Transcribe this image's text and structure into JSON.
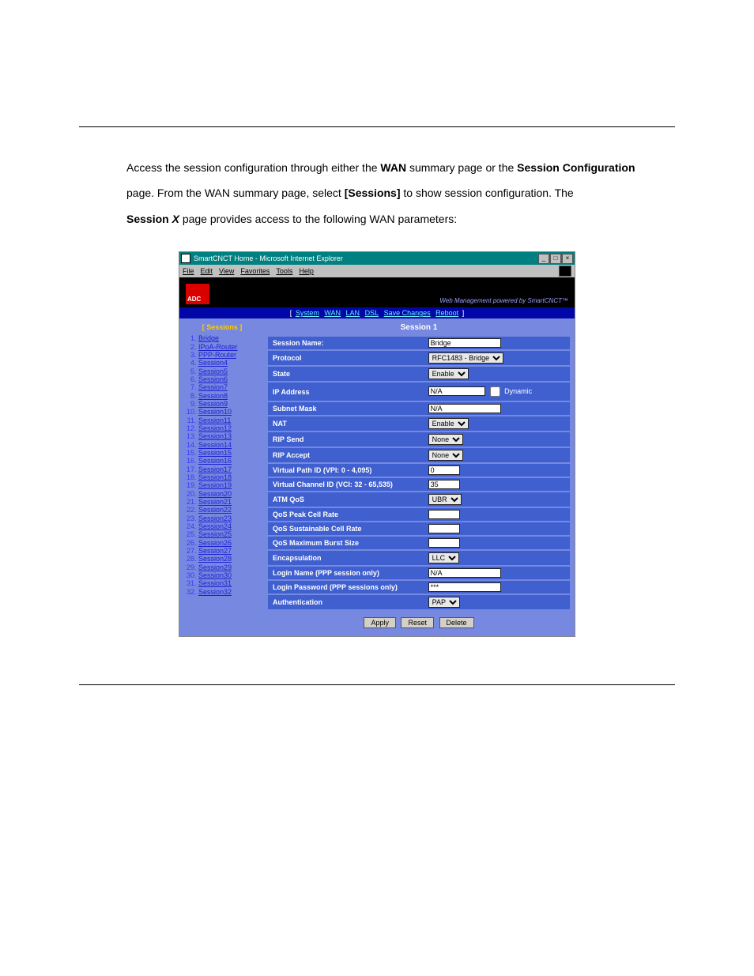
{
  "doc": {
    "line1_pre": "Access the session configuration through either the ",
    "line1_wan": "WAN",
    "line1_mid": " summary page or the ",
    "line1_sc": "Session Configuration",
    "line2_pre": "page. From the WAN summary page, select ",
    "line2_sessions": "[Sessions]",
    "line2_post": " to show session configuration. The",
    "line3_pre": "Session ",
    "line3_x": "X",
    "line3_post": " page provides access to the following WAN parameters:"
  },
  "window": {
    "title": "SmartCNCT Home - Microsoft Internet Explorer",
    "menus": [
      "File",
      "Edit",
      "View",
      "Favorites",
      "Tools",
      "Help"
    ],
    "tagline": "Web Management powered by SmartCNCT™",
    "topnav": [
      "System",
      "WAN",
      "LAN",
      "DSL",
      "Save Changes",
      "Reboot"
    ],
    "sidebar_title": "[ Sessions ]",
    "sidebar_items": [
      "Bridge",
      "IPoA-Router",
      "PPP-Router",
      "Session4",
      "Session5",
      "Session6",
      "Session7",
      "Session8",
      "Session9",
      "Session10",
      "Session11",
      "Session12",
      "Session13",
      "Session14",
      "Session15",
      "Session16",
      "Session17",
      "Session18",
      "Session19",
      "Session20",
      "Session21",
      "Session22",
      "Session23",
      "Session24",
      "Session25",
      "Session26",
      "Session27",
      "Session28",
      "Session29",
      "Session30",
      "Session31",
      "Session32"
    ],
    "session_heading": "Session 1",
    "rows": {
      "session_name": {
        "label": "Session Name:",
        "value": "Bridge"
      },
      "protocol": {
        "label": "Protocol",
        "value": "RFC1483 - Bridge"
      },
      "state": {
        "label": "State",
        "value": "Enable"
      },
      "ip_address": {
        "label": "IP Address",
        "value": "N/A",
        "dynamic": "Dynamic"
      },
      "subnet_mask": {
        "label": "Subnet Mask",
        "value": "N/A"
      },
      "nat": {
        "label": "NAT",
        "value": "Enable"
      },
      "rip_send": {
        "label": "RIP Send",
        "value": "None"
      },
      "rip_accept": {
        "label": "RIP Accept",
        "value": "None"
      },
      "vpi": {
        "label": "Virtual Path ID (VPI: 0 - 4,095)",
        "value": "0"
      },
      "vci": {
        "label": "Virtual Channel ID (VCI: 32 - 65,535)",
        "value": "35"
      },
      "atm_qos": {
        "label": "ATM QoS",
        "value": "UBR"
      },
      "peak": {
        "label": "QoS Peak Cell Rate",
        "value": ""
      },
      "sustain": {
        "label": "QoS Sustainable Cell Rate",
        "value": ""
      },
      "burst": {
        "label": "QoS Maximum Burst Size",
        "value": ""
      },
      "encap": {
        "label": "Encapsulation",
        "value": "LLC"
      },
      "login_name": {
        "label": "Login Name (PPP session only)",
        "value": "N/A"
      },
      "login_pw": {
        "label": "Login Password (PPP sessions only)",
        "value": "***"
      },
      "auth": {
        "label": "Authentication",
        "value": "PAP"
      }
    },
    "buttons": {
      "apply": "Apply",
      "reset": "Reset",
      "delete": "Delete"
    }
  }
}
